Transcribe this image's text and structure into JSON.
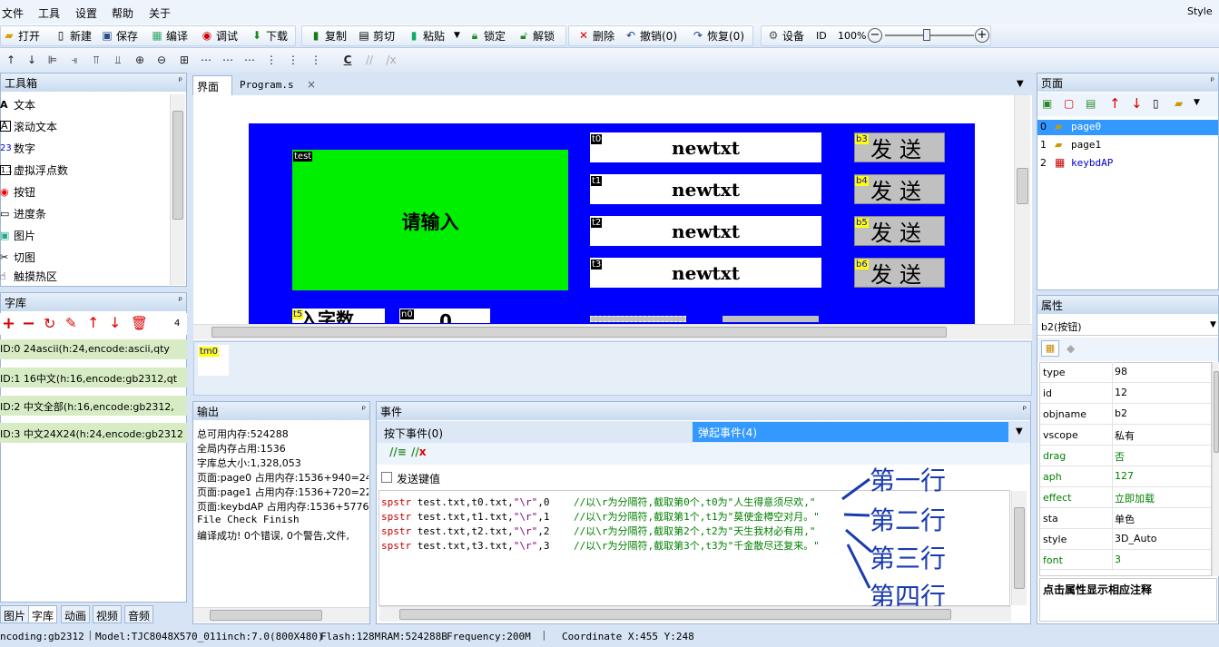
{
  "menu": {
    "file": "文件",
    "tools": "工具",
    "settings": "设置",
    "help": "帮助",
    "about": "关于",
    "style": "Style"
  },
  "toolbar": {
    "open": "打开",
    "new": "新建",
    "save": "保存",
    "compile": "编译",
    "debug": "调试",
    "download": "下载",
    "copy": "复制",
    "cut": "剪切",
    "paste": "粘贴",
    "lock": "锁定",
    "unlock": "解锁",
    "delete": "删除",
    "undo": "撤销(0)",
    "redo": "恢复(0)",
    "device": "设备",
    "id": "ID",
    "zoom": "100%"
  },
  "toolbox": {
    "title": "工具箱",
    "items": [
      "文本",
      "滚动文本",
      "数字",
      "虚拟浮点数",
      "按钮",
      "进度条",
      "图片",
      "切图",
      "触摸热区"
    ]
  },
  "fonts": {
    "title": "字库",
    "count": "4",
    "rows": [
      "ID:0  24ascii(h:24,encode:ascii,qty",
      "ID:1  16中文(h:16,encode:gb2312,qt",
      "ID:2  中文全部(h:16,encode:gb2312,",
      "ID:3  中文24X24(h:24,encode:gb2312"
    ]
  },
  "bottom_tabs": [
    "图片",
    "字库",
    "动画",
    "视频",
    "音频"
  ],
  "editor": {
    "tab_ui": "界面",
    "tab_program": "Program.s",
    "close": "×",
    "timer": "tm0"
  },
  "canvas": {
    "green_tag": "test",
    "green_text": "请输入",
    "texts": [
      {
        "tag": "t0",
        "text": "newtxt"
      },
      {
        "tag": "t1",
        "text": "newtxt"
      },
      {
        "tag": "t2",
        "text": "newtxt"
      },
      {
        "tag": "t3",
        "text": "newtxt"
      }
    ],
    "buttons": [
      {
        "tag": "b3",
        "text": "发送"
      },
      {
        "tag": "b4",
        "text": "发送"
      },
      {
        "tag": "b5",
        "text": "发送"
      },
      {
        "tag": "b6",
        "text": "发送"
      }
    ],
    "bottom_tag1": "t5",
    "bottom_text1": "入字数",
    "bottom_tag2": "n0",
    "bottom_text2": "0"
  },
  "output": {
    "title": "输出",
    "lines": [
      "总可用内存:524288",
      "全局内存占用:1536",
      "字库总大小:1,328,053",
      "页面:page0 占用内存:1536+940=24'",
      "页面:page1 占用内存:1536+720=22!",
      "页面:keybdAP 占用内存:1536+5776:",
      "File Check Finish",
      "编译成功! 0个错误, 0个警告,文件,"
    ]
  },
  "events": {
    "title": "事件",
    "tab_down": "按下事件(0)",
    "tab_up": "弹起事件(4)",
    "send_key": "发送键值",
    "code": [
      {
        "kw": "spstr",
        "args": " test.txt,t0.txt,",
        "str": "\"\\r\"",
        "rest": ",0",
        "comment": "//以\\r为分隔符,截取第0个,t0为\"人生得意须尽欢,\""
      },
      {
        "kw": "spstr",
        "args": " test.txt,t1.txt,",
        "str": "\"\\r\"",
        "rest": ",1",
        "comment": "//以\\r为分隔符,截取第1个,t1为\"莫使金樽空对月。\""
      },
      {
        "kw": "spstr",
        "args": " test.txt,t2.txt,",
        "str": "\"\\r\"",
        "rest": ",2",
        "comment": "//以\\r为分隔符,截取第2个,t2为\"天生我材必有用,\""
      },
      {
        "kw": "spstr",
        "args": " test.txt,t3.txt,",
        "str": "\"\\r\"",
        "rest": ",3",
        "comment": "//以\\r为分隔符,截取第3个,t3为\"千金散尽还复来。\""
      }
    ],
    "annotations": [
      "第一行",
      "第二行",
      "第三行",
      "第四行"
    ]
  },
  "pages": {
    "title": "页面",
    "items": [
      {
        "idx": "0",
        "name": "page0"
      },
      {
        "idx": "1",
        "name": "page1"
      },
      {
        "idx": "2",
        "name": "keybdAP"
      }
    ]
  },
  "props": {
    "title": "属性",
    "selected": "b2(按钮)",
    "hint": "点击属性显示相应注释",
    "rows": [
      {
        "k": "type",
        "v": "98"
      },
      {
        "k": "id",
        "v": "12"
      },
      {
        "k": "objname",
        "v": "b2"
      },
      {
        "k": "vscope",
        "v": "私有"
      },
      {
        "k": "drag",
        "v": "否"
      },
      {
        "k": "aph",
        "v": "127"
      },
      {
        "k": "effect",
        "v": "立即加载"
      },
      {
        "k": "sta",
        "v": "单色"
      },
      {
        "k": "style",
        "v": "3D_Auto"
      },
      {
        "k": "font",
        "v": "3"
      }
    ]
  },
  "status": {
    "encoding": "ncoding:gb2312",
    "model": "Model:TJC8048X570_011",
    "inch": "inch:7.0(800X480)",
    "flash": "Flash:128M",
    "ram": "RAM:524288B",
    "freq": "Frequency:200M",
    "coord": "Coordinate X:455  Y:248"
  },
  "colors": {
    "accent": "#3399ff",
    "canvas_bg": "#0000ff",
    "green": "#00ee00",
    "tag_yellow": "#ffff00"
  }
}
